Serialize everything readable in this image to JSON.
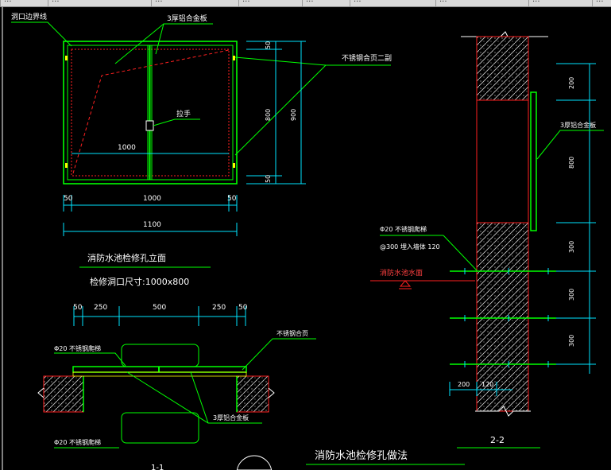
{
  "tabs": [
    "...",
    "...",
    "...",
    "...",
    "...",
    "...",
    "...",
    "...",
    "..."
  ],
  "elevation": {
    "label_opening_line": "洞口边界线",
    "label_panel_top": "3厚铝合金板",
    "label_handle": "拉手",
    "label_hinge": "不锈钢合页二副",
    "dim_inner_width": "1000",
    "dims_bottom": [
      "50",
      "1000",
      "50"
    ],
    "dim_total_width": "1100",
    "dims_right_small": [
      "50",
      "50"
    ],
    "dim_right_800": "800",
    "dim_right_900": "900",
    "title": "消防水池检修孔立面",
    "subtitle": "检修洞口尺寸:1000x800"
  },
  "section11": {
    "dims_top": [
      "50",
      "250",
      "500",
      "250",
      "50"
    ],
    "label_ladder_top": "Φ20 不锈钢爬梯",
    "label_hinge": "不锈钢合页",
    "label_panel": "3厚铝合金板",
    "label_ladder_bottom": "Φ20 不锈钢爬梯",
    "title": "1-1"
  },
  "section22": {
    "dims_right": [
      "200",
      "800",
      "300",
      "300",
      "300"
    ],
    "label_panel": "3厚铝合金板",
    "label_ladder_l1": "Φ20 不锈钢爬梯",
    "label_ladder_l2": "@300 埋入墙体 120",
    "label_water": "消防水池水面",
    "dims_bottom": [
      "200",
      "120"
    ],
    "title": "2-2"
  },
  "main_title": "消防水池检修孔做法",
  "colors": {
    "green": "#00ff00",
    "red": "#ff2020",
    "cyan": "#00e5ff",
    "white": "#ffffff",
    "yellow": "#ffff00",
    "magenta": "#ff40ff",
    "background": "#000000"
  }
}
